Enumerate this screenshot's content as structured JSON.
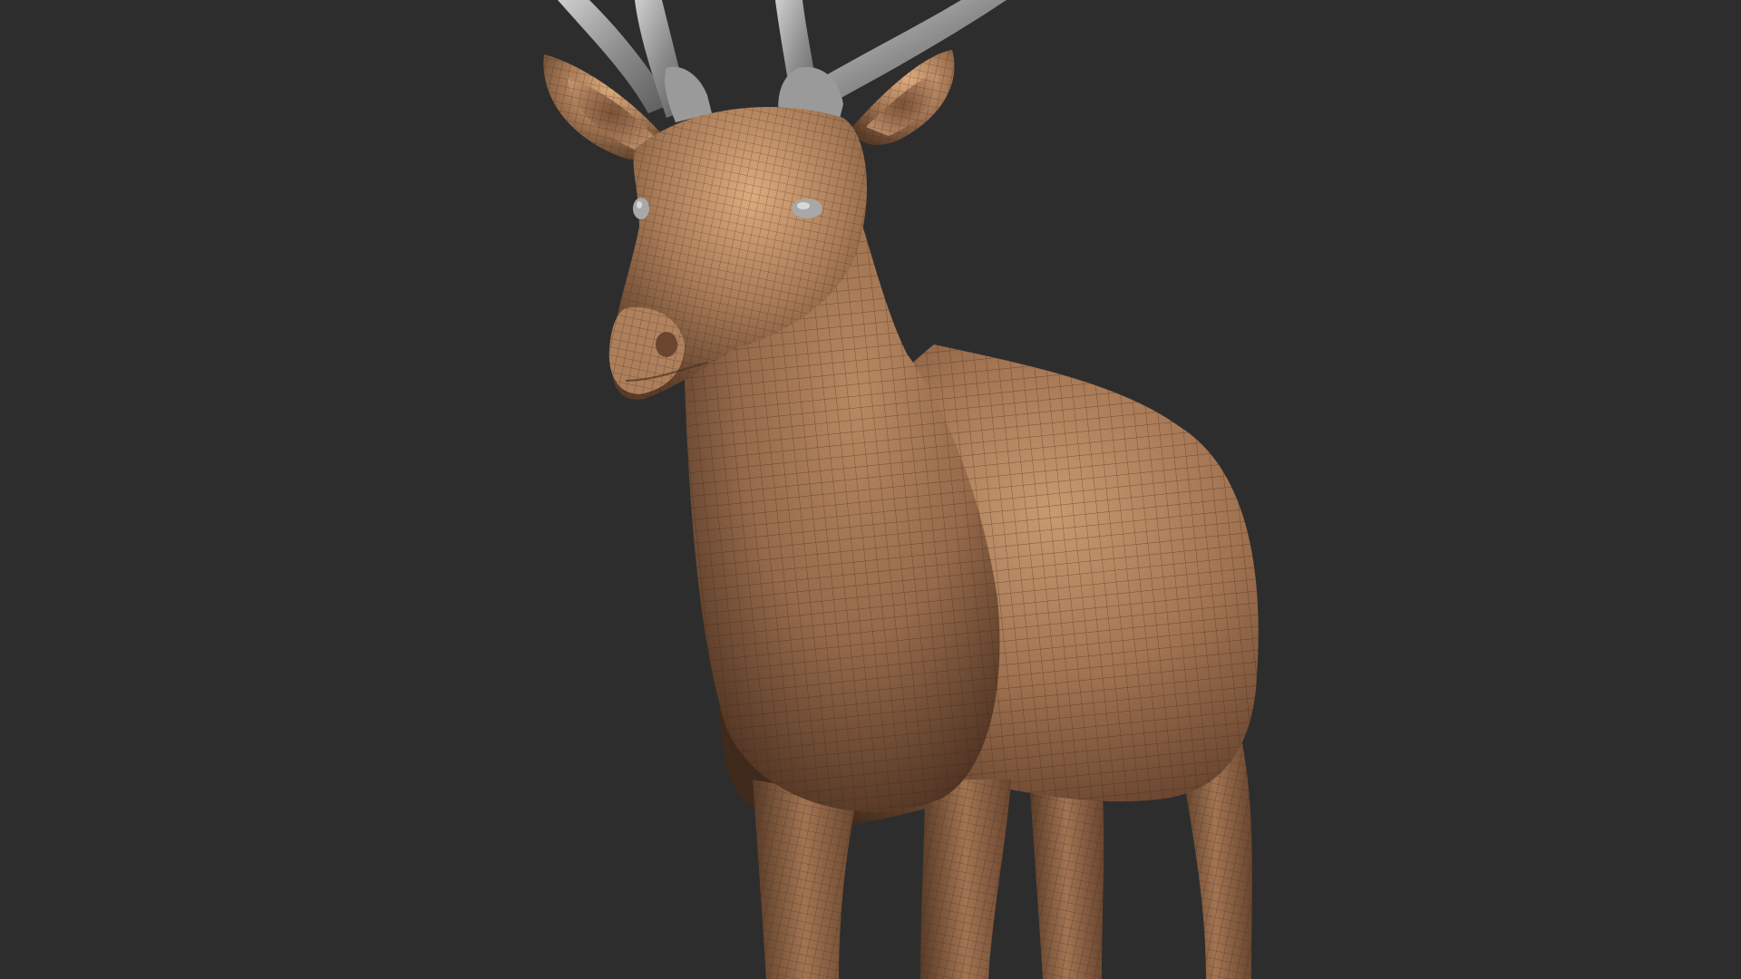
{
  "viewport": {
    "background_color": "#2d2d2d",
    "model_subject": "deer",
    "model_skin_color": "#9c6e4c",
    "model_skin_highlight": "#d4a073",
    "model_skin_shadow": "#4a3020",
    "antler_color": "#8c8c8c",
    "antler_highlight": "#cfcfcf",
    "eye_color": "#b0b0b0",
    "wireframe_color": "#3a2416"
  }
}
